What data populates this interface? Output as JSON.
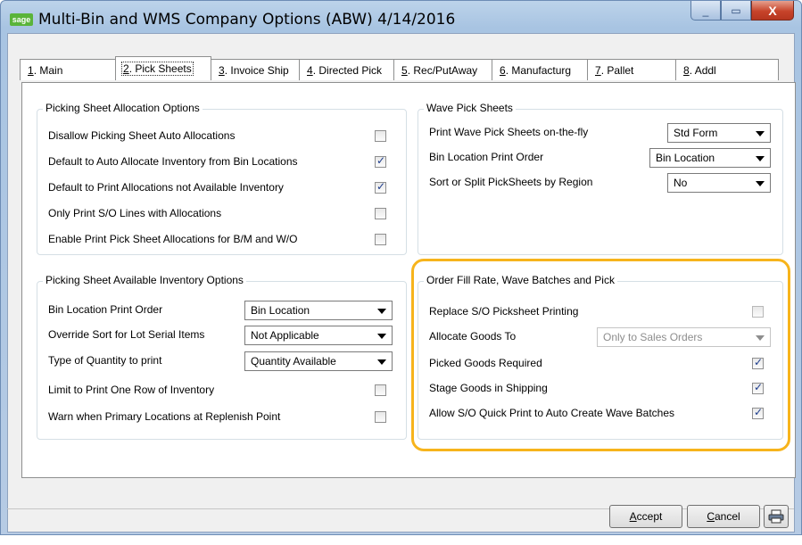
{
  "window": {
    "logo_text": "sage",
    "title": "Multi-Bin and WMS Company Options (ABW) 4/14/2016",
    "minimize": "_",
    "maximize": "▭",
    "close": "X"
  },
  "tabs": [
    {
      "key": "1",
      "rest": ". Main"
    },
    {
      "key": "2",
      "rest": ". Pick Sheets"
    },
    {
      "key": "3",
      "rest": ". Invoice Ship"
    },
    {
      "key": "4",
      "rest": ". Directed Pick"
    },
    {
      "key": "5",
      "rest": ". Rec/PutAway"
    },
    {
      "key": "6",
      "rest": ". Manufacturg"
    },
    {
      "key": "7",
      "rest": ". Pallet"
    },
    {
      "key": "8",
      "rest": ". Addl"
    }
  ],
  "allocation": {
    "title": "Picking Sheet Allocation Options",
    "items": [
      {
        "label": "Disallow Picking Sheet Auto Allocations",
        "checked": false
      },
      {
        "label": "Default to Auto Allocate Inventory from Bin Locations",
        "checked": true
      },
      {
        "label": "Default to Print Allocations not Available Inventory",
        "checked": true
      },
      {
        "label": "Only Print S/O Lines with Allocations",
        "checked": false
      },
      {
        "label": "Enable Print Pick Sheet Allocations for B/M and W/O",
        "checked": false
      }
    ]
  },
  "wave": {
    "title": "Wave Pick Sheets",
    "print_label": "Print Wave Pick Sheets on-the-fly",
    "print_value": "Std Form",
    "order_label": "Bin Location Print Order",
    "order_value": "Bin Location",
    "sort_label": "Sort or Split PickSheets by Region",
    "sort_value": "No"
  },
  "available": {
    "title": "Picking Sheet Available Inventory Options",
    "order_label": "Bin Location Print Order",
    "order_value": "Bin Location",
    "override_label": "Override Sort for Lot Serial Items",
    "override_value": "Not Applicable",
    "qty_label": "Type of Quantity to print",
    "qty_value": "Quantity Available",
    "limit_label": "Limit to Print One Row of Inventory",
    "limit_checked": false,
    "warn_label": "Warn when Primary Locations at Replenish Point",
    "warn_checked": false
  },
  "fill": {
    "title": "Order Fill Rate, Wave Batches and Pick",
    "replace_label": "Replace S/O Picksheet Printing",
    "replace_checked": false,
    "allocate_label": "Allocate Goods To",
    "allocate_value": "Only to Sales Orders",
    "picked_label": "Picked Goods Required",
    "picked_checked": true,
    "stage_label": "Stage Goods in Shipping",
    "stage_checked": true,
    "allow_label": "Allow S/O Quick Print to Auto Create Wave Batches",
    "allow_checked": true
  },
  "buttons": {
    "accept_key": "A",
    "accept_rest": "ccept",
    "cancel_key": "C",
    "cancel_rest": "ancel"
  },
  "colors": {
    "highlight": "#f7b41c",
    "check": "#1c3c8c"
  }
}
